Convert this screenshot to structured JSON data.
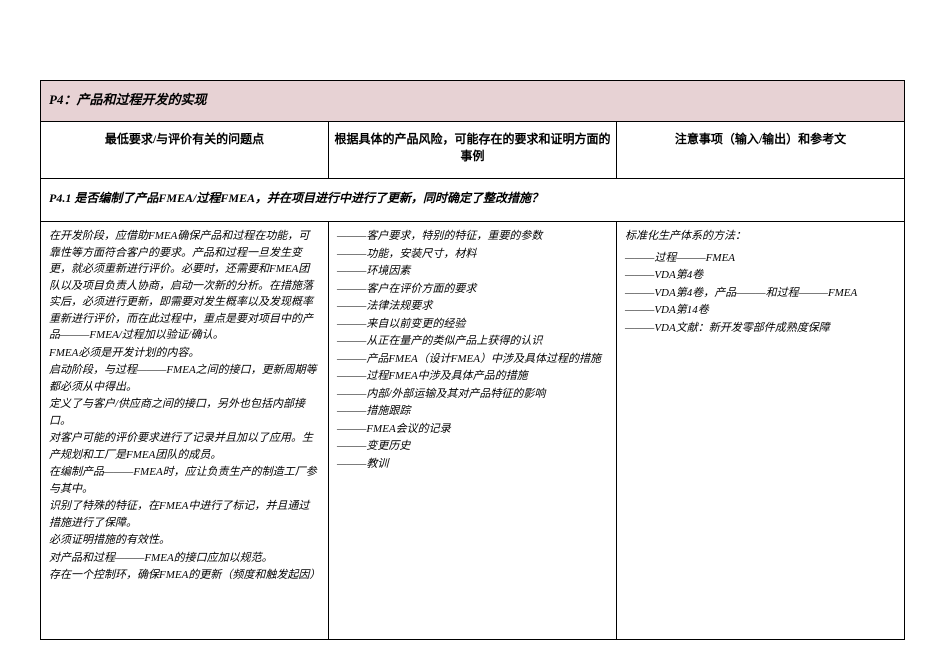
{
  "title": "P4：产品和过程开发的实现",
  "headers": {
    "col1": "最低要求/与评价有关的问题点",
    "col2": "根据具体的产品风险，可能存在的要求和证明方面的事例",
    "col3": "注意事项（输入/输出）和参考文"
  },
  "question": "P4.1 是否编制了产品FMEA/过程FMEA，并在项目进行中进行了更新，同时确定了整改措施？",
  "col1_text": "在开发阶段，应借助FMEA确保产品和过程在功能，可靠性等方面符合客户的要求。产品和过程一旦发生变更，就必须重新进行评价。必要时，还需要和FMEA团队以及项目负责人协商，启动一次新的分析。在措施落实后，必须进行更新，即需要对发生概率以及发现概率重新进行评价，而在此过程中，重点是要对项目中的产品———FMEA/过程加以验证/确认。\nFMEA必须是开发计划的内容。\n启动阶段，与过程———FMEA之间的接口，更新周期等都必须从中得出。\n定义了与客户/供应商之间的接口，另外也包括内部接口。\n对客户可能的评价要求进行了记录并且加以了应用。生产规划和工厂是FMEA团队的成员。\n在编制产品———FMEA时，应让负责生产的制造工厂参与其中。\n识别了特殊的特征，在FMEA中进行了标记，并且通过措施进行了保障。\n必须证明措施的有效性。\n对产品和过程———FMEA的接口应加以规范。\n存在一个控制环，确保FMEA的更新（频度和触发起因）",
  "col2_items": [
    "———客户要求，特别的特征，重要的参数",
    "———功能，安装尺寸，材料",
    "———环境因素",
    "———客户在评价方面的要求",
    "———法律法规要求",
    "———来自以前变更的经验",
    "———从正在量产的类似产品上获得的认识",
    "———产品FMEA（设计FMEA）中涉及具体过程的措施",
    "———过程FMEA中涉及具体产品的措施",
    "———内部/外部运输及其对产品特征的影响",
    "———措施跟踪",
    "———FMEA会议的记录",
    "———变更历史",
    "———教训"
  ],
  "col3_title": "标准化生产体系的方法：",
  "col3_items": [
    "———过程———FMEA",
    "———VDA第4卷",
    "———VDA第4卷，产品———和过程———FMEA",
    "———VDA第14卷",
    "———VDA文献：新开发零部件成熟度保障"
  ]
}
